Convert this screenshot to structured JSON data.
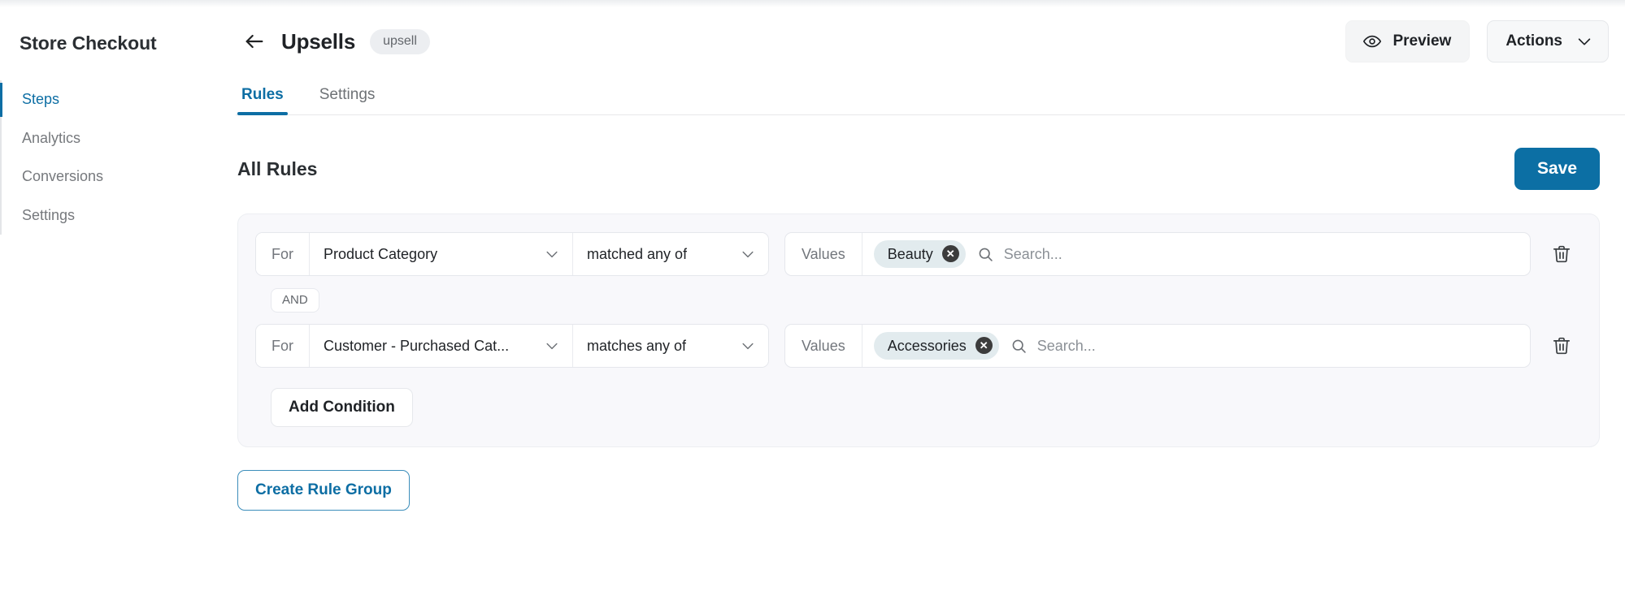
{
  "sidebar": {
    "title": "Store Checkout",
    "items": [
      {
        "label": "Steps",
        "active": true
      },
      {
        "label": "Analytics",
        "active": false
      },
      {
        "label": "Conversions",
        "active": false
      },
      {
        "label": "Settings",
        "active": false
      }
    ]
  },
  "header": {
    "back_icon": "arrow-left-icon",
    "title": "Upsells",
    "badge": "upsell",
    "preview_label": "Preview",
    "preview_icon": "eye-icon",
    "actions_label": "Actions",
    "actions_icon": "chevron-down-icon"
  },
  "tabs": [
    {
      "label": "Rules",
      "active": true
    },
    {
      "label": "Settings",
      "active": false
    }
  ],
  "section": {
    "title": "All Rules",
    "save_label": "Save",
    "save_color": "#0c6fa4"
  },
  "rule_group": {
    "connector_label": "AND",
    "add_condition_label": "Add Condition",
    "conditions": [
      {
        "for_label": "For",
        "field": "Product Category",
        "operator": "matched any of",
        "values_label": "Values",
        "chips": [
          "Beauty"
        ],
        "search_placeholder": "Search...",
        "search_value": "",
        "delete_icon": "trash-icon"
      },
      {
        "for_label": "For",
        "field": "Customer - Purchased Cat...",
        "operator": "matches any of",
        "values_label": "Values",
        "chips": [
          "Accessories"
        ],
        "search_placeholder": "Search...",
        "search_value": "",
        "delete_icon": "trash-icon"
      }
    ]
  },
  "footer": {
    "create_rule_group_label": "Create Rule Group",
    "accent_color": "#0d6ea4"
  }
}
